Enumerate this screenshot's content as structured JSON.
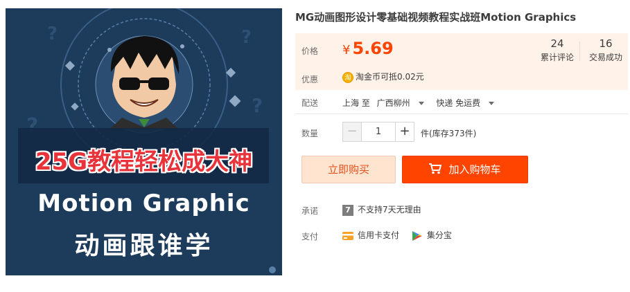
{
  "product": {
    "title": "MG动画图形设计零基础视频教程实战班Motion Graphics",
    "image": {
      "banner_text": "25G教程轻松成大神",
      "main_text": "Motion Graphic",
      "sub_text": "动画跟谁学"
    }
  },
  "price": {
    "label": "价格",
    "currency": "¥",
    "amount": "5.69",
    "comments_count": "24",
    "comments_label": "累计评论",
    "sales_count": "16",
    "sales_label": "交易成功"
  },
  "promo": {
    "label": "优惠",
    "icon_text": "淘",
    "text": "淘金币可抵0.02元"
  },
  "shipping": {
    "label": "配送",
    "from": "上海 至",
    "to": "广西柳州",
    "method": "快递 免运费"
  },
  "quantity": {
    "label": "数量",
    "minus": "−",
    "value": "1",
    "plus": "+",
    "stock_text": "件(库存373件)"
  },
  "actions": {
    "buy_now": "立即购买",
    "add_to_cart": "加入购物车"
  },
  "promise": {
    "label": "承诺",
    "icon_text": "7",
    "text": "不支持7天无理由"
  },
  "payment": {
    "label": "支付",
    "methods": [
      "信用卡支付",
      "集分宝"
    ]
  },
  "colors": {
    "accent": "#ff4400",
    "price_bg": "#fff2e8",
    "image_bg": "#1d3b5b"
  }
}
